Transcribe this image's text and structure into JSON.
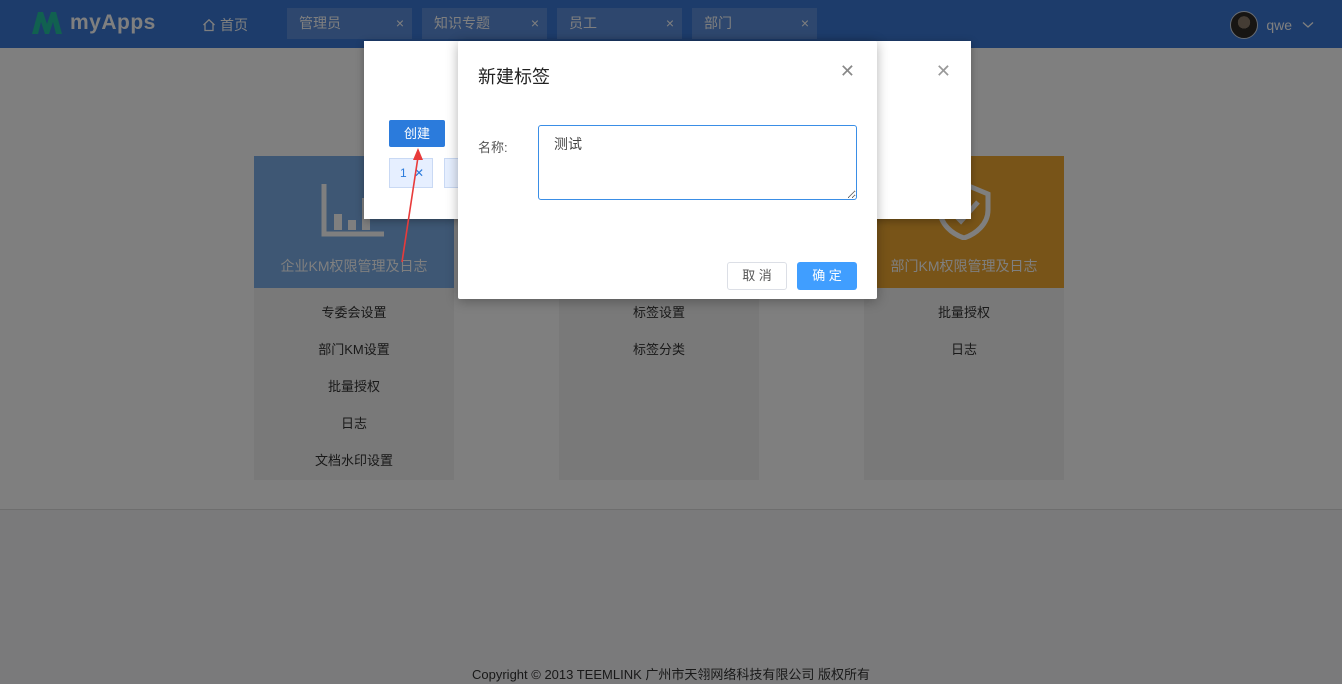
{
  "header": {
    "app_name": "myApps",
    "home_label": "首页",
    "tabs": [
      {
        "label": "管理员"
      },
      {
        "label": "知识专题"
      },
      {
        "label": "员工"
      },
      {
        "label": "部门"
      }
    ],
    "tab_close_glyph": "×",
    "username": "qwe"
  },
  "cards": [
    {
      "title": "企业KM权限管理及日志",
      "color": "#7daee8",
      "icon": "bar-chart-icon",
      "items": [
        "专委会设置",
        "部门KM设置",
        "批量授权",
        "日志",
        "文档水印设置"
      ]
    },
    {
      "title": "",
      "color": "#f3f3f3",
      "icon": "",
      "items": [
        "标签设置",
        "标签分类"
      ]
    },
    {
      "title": "部门KM权限管理及日志",
      "color": "#f0a830",
      "icon": "shield-check-icon",
      "items": [
        "批量授权",
        "日志"
      ]
    }
  ],
  "footer": {
    "copyright": "Copyright © 2013 TEEMLINK 广州市天翎网络科技有限公司 版权所有"
  },
  "background_modal": {
    "create_label": "创建",
    "chips": [
      "1"
    ]
  },
  "dialog": {
    "title": "新建标签",
    "name_label": "名称:",
    "name_value": "测试",
    "cancel_label": "取 消",
    "confirm_label": "确 定"
  },
  "colors": {
    "header_bg": "#3a78d6",
    "primary": "#409eff",
    "annotation_arrow": "#e83b3b"
  }
}
